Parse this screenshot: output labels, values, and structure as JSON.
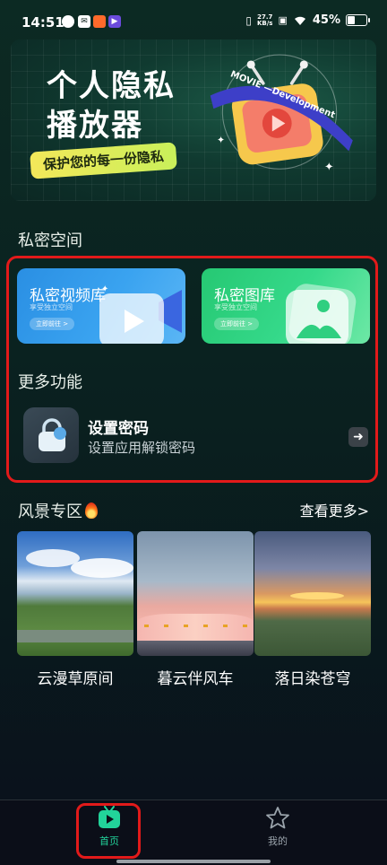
{
  "status_bar": {
    "time": "14:51",
    "net_speed_value": "27.7",
    "net_speed_unit": "KB/s",
    "battery": "45%",
    "battery_level": 0.45
  },
  "banner": {
    "title_line1": "个人隐私",
    "title_line2": "播放器",
    "tagline": "保护您的每一份隐私",
    "ribbon_text": "MOVIE —Development"
  },
  "private_space": {
    "title": "私密空间",
    "cards": [
      {
        "title": "私密视频库",
        "subtitle": "享受独立空间",
        "button": "立即前往 >"
      },
      {
        "title": "私密图库",
        "subtitle": "享受独立空间",
        "button": "立即前往 >"
      }
    ]
  },
  "more_features": {
    "title": "更多功能",
    "password": {
      "title": "设置密码",
      "subtitle": "设置应用解锁密码",
      "arrow": "➜"
    }
  },
  "scenic": {
    "title": "风景专区",
    "see_more": "查看更多>",
    "photos": [
      {
        "caption": "云漫草原间"
      },
      {
        "caption": "暮云伴风车"
      },
      {
        "caption": "落日染苍穹"
      }
    ]
  },
  "bottom_nav": {
    "items": [
      {
        "label": "首页",
        "icon": "tv-play-icon",
        "active": true
      },
      {
        "label": "我的",
        "icon": "star-icon",
        "active": false
      }
    ]
  },
  "colors": {
    "accent_green": "#22d39a",
    "highlight_red": "#e21a1a",
    "tagline_yellow": "#f3e85a"
  }
}
